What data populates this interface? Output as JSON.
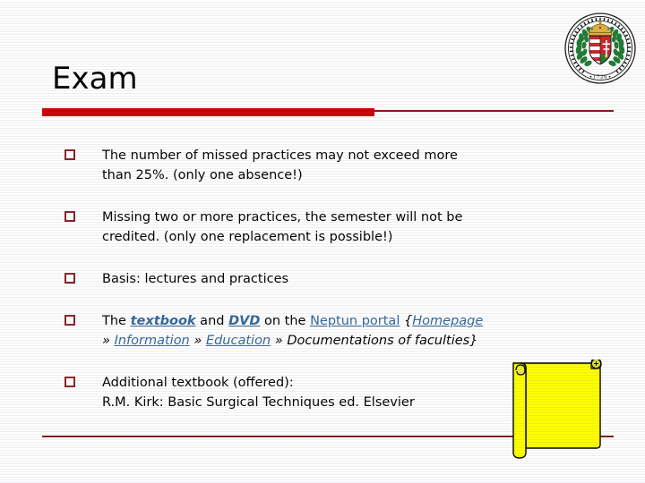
{
  "slide": {
    "title": "Exam",
    "logo_name": "university-of-pecs-seal",
    "logo_year": "1726",
    "logo_motto": "UNIVERSITAS QUINQUEECCLESIENSIS DE PETRO PAZMANY",
    "accent_color": "#cc0000",
    "rule_color": "#8b1a1a",
    "bullet_color": "#8b2028",
    "link_color": "#33669a",
    "text_color": "#000000",
    "shape_fill": "#ffff00",
    "shape_outline": "#000000"
  },
  "bullets": [
    {
      "marker": "square-bullet",
      "line1": "The number of missed practices may not exceed more",
      "line2": "than 25%. (only one absence!)"
    },
    {
      "marker": "square-bullet",
      "line1": "Missing two or more practices, the semester will not be",
      "line2": "credited. (only one replacement is possible!)"
    },
    {
      "marker": "square-bullet",
      "line1": "Basis: lectures and practices",
      "line2": ""
    },
    {
      "marker": "square-bullet",
      "rich": {
        "t1": "The ",
        "link_textbook": "textbook",
        "t2": " and ",
        "link_dvd": "DVD",
        "t3": " on the ",
        "link_neptun": "Neptun portal",
        "t4": " {",
        "link_homepage": "Homepage",
        "sep1": " » ",
        "link_information": "Information",
        "sep2": " » ",
        "link_education": "Education",
        "sep3": " » ",
        "t5": "Documentations of faculties}"
      }
    },
    {
      "marker": "square-bullet",
      "line1": "Additional textbook (offered):",
      "line2": "R.M. Kirk: Basic Surgical Techniques ed. Elsevier"
    }
  ]
}
